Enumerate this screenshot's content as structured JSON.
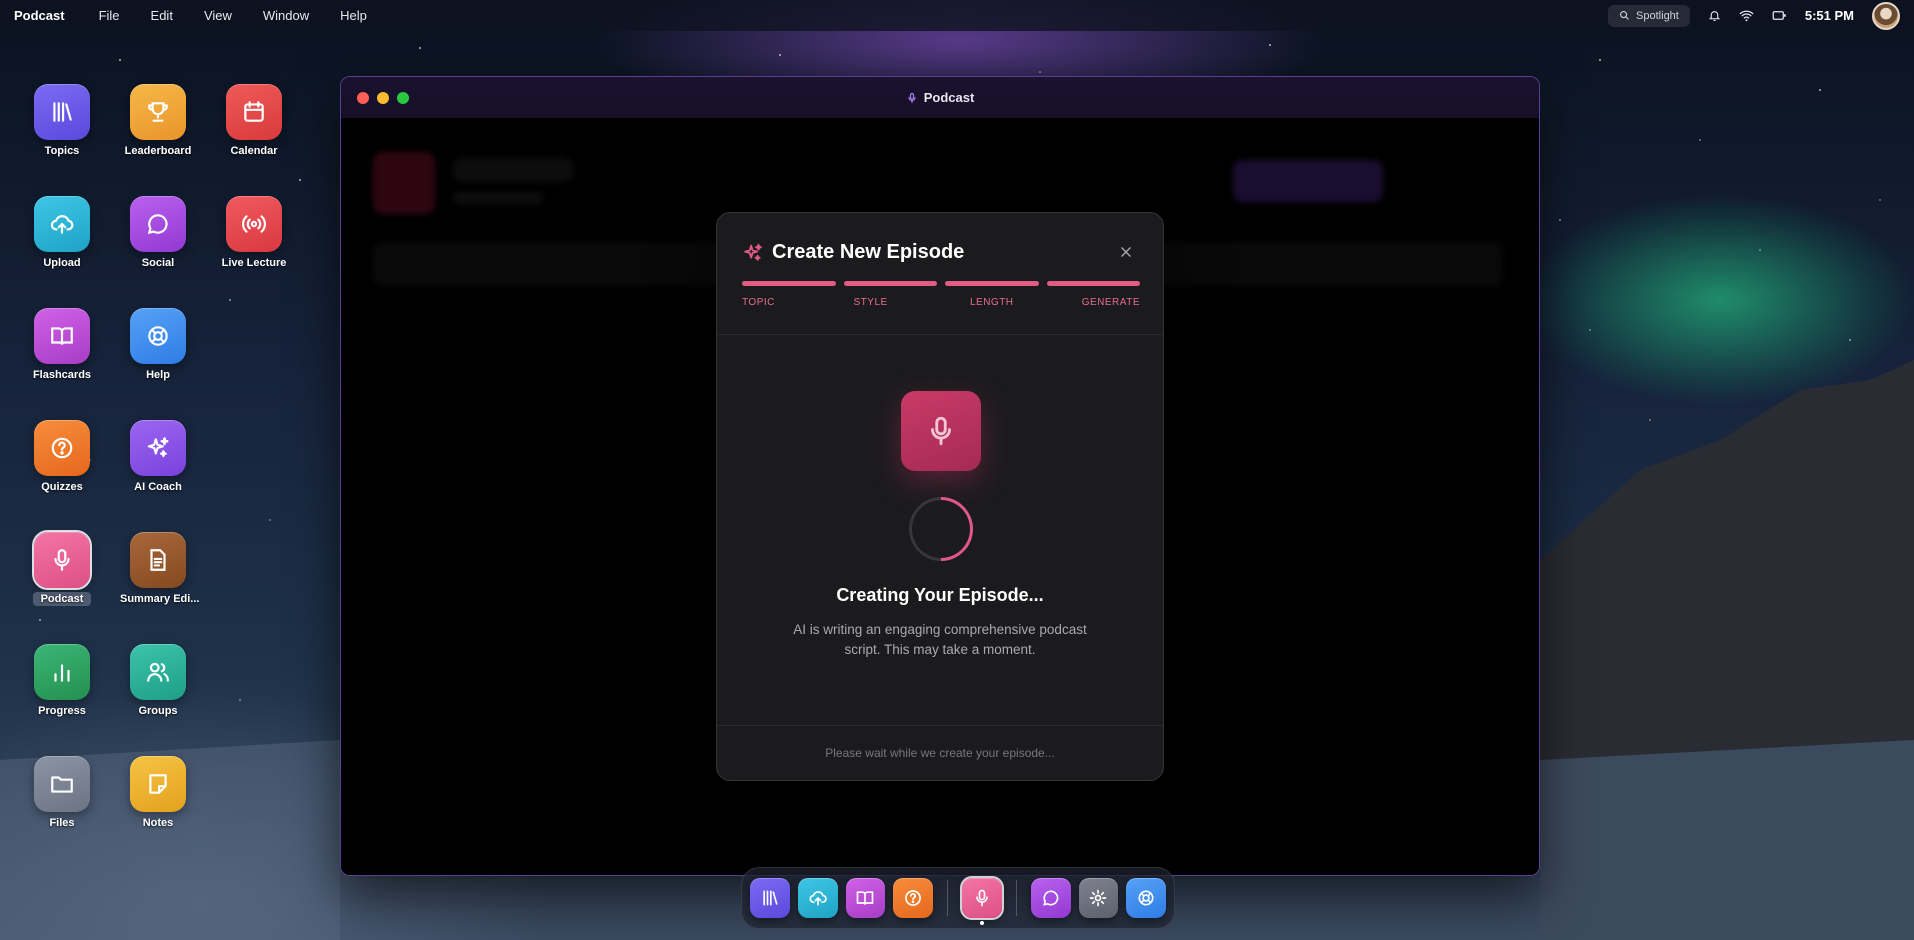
{
  "menubar": {
    "app_name": "Podcast",
    "menus": [
      "File",
      "Edit",
      "View",
      "Window",
      "Help"
    ],
    "spotlight_label": "Spotlight",
    "clock": "5:51 PM"
  },
  "desktop_icons": [
    {
      "label": "Topics",
      "icon": "library-icon",
      "color": "#6d5bea"
    },
    {
      "label": "Leaderboard",
      "icon": "trophy-icon",
      "color": "#f1a63a"
    },
    {
      "label": "Calendar",
      "icon": "calendar-icon",
      "color": "#e44b4b"
    },
    {
      "label": "Upload",
      "icon": "cloud-upload-icon",
      "color": "#2db6d6"
    },
    {
      "label": "Social",
      "icon": "chat-bubble-icon",
      "color": "#a64fe0"
    },
    {
      "label": "Live Lecture",
      "icon": "broadcast-icon",
      "color": "#e8464e"
    },
    {
      "label": "Flashcards",
      "icon": "book-open-icon",
      "color": "#c04fd8"
    },
    {
      "label": "Help",
      "icon": "lifebuoy-icon",
      "color": "#3f8ff0"
    },
    {
      "label": "Quizzes",
      "icon": "question-circle-icon",
      "color": "#f17a2b"
    },
    {
      "label": "AI Coach",
      "icon": "sparkles-icon",
      "color": "#8d55ea"
    },
    {
      "label": "Podcast",
      "icon": "microphone-icon",
      "color": "#ea5f95"
    },
    {
      "label": "Summary Edi...",
      "icon": "document-icon",
      "color": "#9a5a2e"
    },
    {
      "label": "Progress",
      "icon": "bar-chart-icon",
      "color": "#2f9e63"
    },
    {
      "label": "Groups",
      "icon": "users-icon",
      "color": "#2db39a"
    },
    {
      "label": "Files",
      "icon": "folder-icon",
      "color": "#7d8594"
    },
    {
      "label": "Notes",
      "icon": "note-icon",
      "color": "#f0b52e"
    }
  ],
  "window": {
    "title": "Podcast",
    "title_icon": "microphone-icon"
  },
  "modal": {
    "title": "Create New Episode",
    "title_icon": "sparkles-icon",
    "close_icon": "close-icon",
    "steps": [
      "TOPIC",
      "STYLE",
      "LENGTH",
      "GENERATE"
    ],
    "creating_title": "Creating Your Episode...",
    "creating_desc": "AI is writing an engaging comprehensive podcast script. This may take a moment.",
    "footer": "Please wait while we create your episode...",
    "accent": "#e25c86"
  },
  "dock": [
    {
      "icon": "library-icon",
      "color": "#6d5bea"
    },
    {
      "icon": "cloud-upload-icon",
      "color": "#2db6d6"
    },
    {
      "icon": "book-open-icon",
      "color": "#c04fd8"
    },
    {
      "icon": "question-circle-icon",
      "color": "#f17a2b"
    },
    {
      "icon": "microphone-icon",
      "color": "#ea5f95"
    },
    {
      "icon": "chat-bubble-icon",
      "color": "#a64fe0"
    },
    {
      "icon": "gear-icon",
      "color": "#6f7380"
    },
    {
      "icon": "lifebuoy-icon",
      "color": "#3f8ff0"
    }
  ]
}
